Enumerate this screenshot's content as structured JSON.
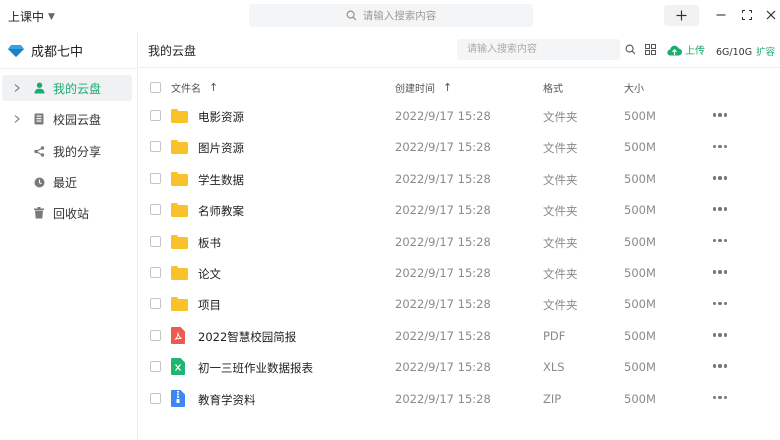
{
  "topbar": {
    "status_label": "上课中",
    "search_placeholder": "请输入搜索内容"
  },
  "sidebar": {
    "brand": "成都七中",
    "items": [
      {
        "label": "我的云盘",
        "icon": "user-icon",
        "expandable": true,
        "active": true
      },
      {
        "label": "校园云盘",
        "icon": "building-icon",
        "expandable": true,
        "active": false
      },
      {
        "label": "我的分享",
        "icon": "share-icon",
        "expandable": false,
        "active": false
      },
      {
        "label": "最近",
        "icon": "clock-icon",
        "expandable": false,
        "active": false
      },
      {
        "label": "回收站",
        "icon": "trash-icon",
        "expandable": false,
        "active": false
      }
    ]
  },
  "main": {
    "title": "我的云盘",
    "search_placeholder": "请输入搜索内容",
    "upload_label": "上传",
    "quota": "6G/10G",
    "expand_label": "扩容",
    "columns": {
      "name": "文件名",
      "time": "创建时间",
      "format": "格式",
      "size": "大小"
    },
    "files": [
      {
        "name": "电影资源",
        "time": "2022/9/17 15:28",
        "format": "文件夹",
        "size": "500M",
        "icon": "folder-icon"
      },
      {
        "name": "图片资源",
        "time": "2022/9/17 15:28",
        "format": "文件夹",
        "size": "500M",
        "icon": "folder-icon"
      },
      {
        "name": "学生数据",
        "time": "2022/9/17 15:28",
        "format": "文件夹",
        "size": "500M",
        "icon": "folder-icon"
      },
      {
        "name": "名师教案",
        "time": "2022/9/17 15:28",
        "format": "文件夹",
        "size": "500M",
        "icon": "folder-icon"
      },
      {
        "name": "板书",
        "time": "2022/9/17 15:28",
        "format": "文件夹",
        "size": "500M",
        "icon": "folder-icon"
      },
      {
        "name": "论文",
        "time": "2022/9/17 15:28",
        "format": "文件夹",
        "size": "500M",
        "icon": "folder-icon"
      },
      {
        "name": "项目",
        "time": "2022/9/17 15:28",
        "format": "文件夹",
        "size": "500M",
        "icon": "folder-icon"
      },
      {
        "name": "2022智慧校园简报",
        "time": "2022/9/17 15:28",
        "format": "PDF",
        "size": "500M",
        "icon": "pdf-file-icon"
      },
      {
        "name": "初一三班作业数据报表",
        "time": "2022/9/17 15:28",
        "format": "XLS",
        "size": "500M",
        "icon": "xls-file-icon"
      },
      {
        "name": "教育学资料",
        "time": "2022/9/17 15:28",
        "format": "ZIP",
        "size": "500M",
        "icon": "zip-file-icon"
      }
    ]
  },
  "colors": {
    "accent": "#1aad6e",
    "folder": "#f8c22b",
    "pdf": "#ee5a4f",
    "xls": "#21b573",
    "zip": "#3d86f4"
  }
}
